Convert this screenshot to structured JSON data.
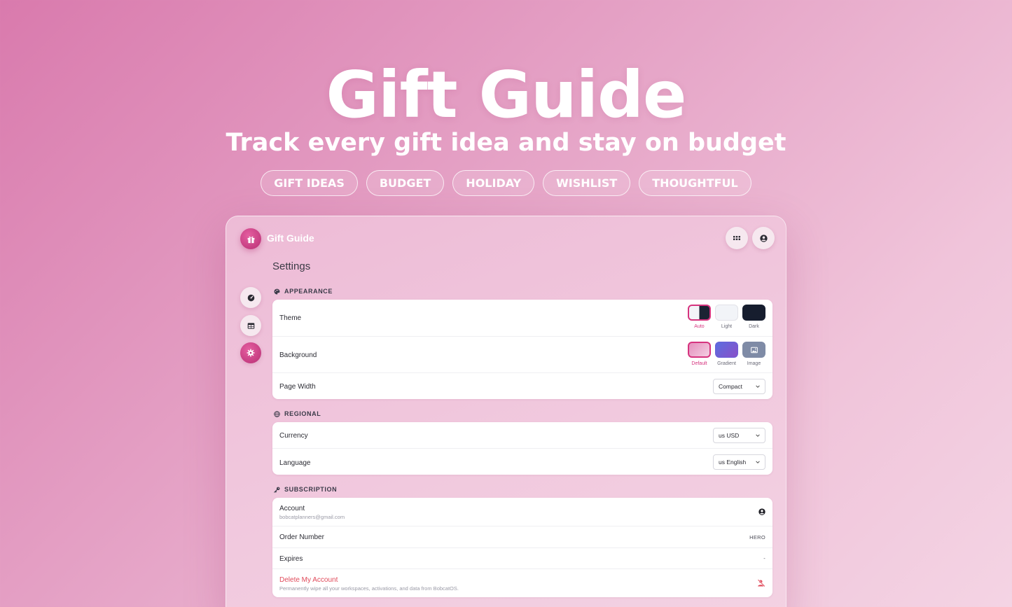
{
  "hero": {
    "title": "Gift Guide",
    "subtitle": "Track every gift idea and stay on budget",
    "tags": [
      "GIFT IDEAS",
      "BUDGET",
      "HOLIDAY",
      "WISHLIST",
      "THOUGHTFUL"
    ]
  },
  "app": {
    "title": "Gift Guide",
    "page_title": "Settings",
    "accent_color": "#d6337e"
  },
  "sidebar": {
    "items": [
      {
        "icon": "dashboard-icon",
        "active": false
      },
      {
        "icon": "table-icon",
        "active": false
      },
      {
        "icon": "gear-icon",
        "active": true
      }
    ]
  },
  "appearance": {
    "section_label": "APPEARANCE",
    "theme": {
      "label": "Theme",
      "options": [
        "Auto",
        "Light",
        "Dark"
      ],
      "selected": "Auto"
    },
    "background": {
      "label": "Background",
      "options": [
        "Default",
        "Gradient",
        "Image"
      ],
      "selected": "Default"
    },
    "page_width": {
      "label": "Page Width",
      "value": "Compact"
    }
  },
  "regional": {
    "section_label": "REGIONAL",
    "currency": {
      "label": "Currency",
      "value": "us USD"
    },
    "language": {
      "label": "Language",
      "value": "us English"
    }
  },
  "subscription": {
    "section_label": "SUBSCRIPTION",
    "account": {
      "label": "Account",
      "email": "bobcatplanners@gmail.com"
    },
    "order_number": {
      "label": "Order Number",
      "value": "HERO"
    },
    "expires": {
      "label": "Expires",
      "value": "-"
    },
    "delete": {
      "label": "Delete My Account",
      "description": "Permanently wipe all your workspaces, activations, and data from BobcatOS."
    }
  }
}
